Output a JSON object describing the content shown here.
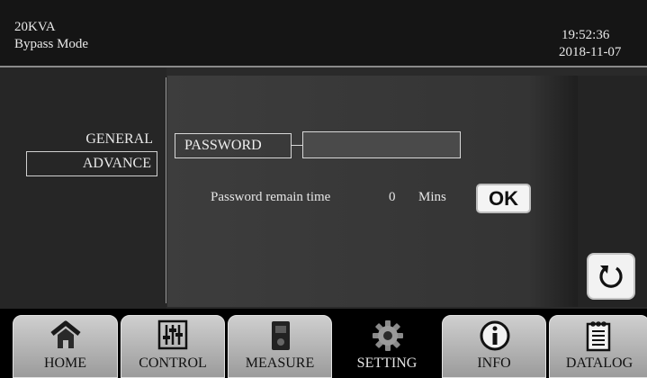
{
  "header": {
    "rating": "20KVA",
    "mode": "Bypass Mode",
    "time": "19:52:36",
    "date": "2018-11-07"
  },
  "menu": {
    "items": [
      {
        "label": "GENERAL",
        "selected": false
      },
      {
        "label": "ADVANCE",
        "selected": true
      }
    ]
  },
  "password": {
    "label": "PASSWORD",
    "value": "",
    "remain_label": "Password remain time",
    "remain_value": "0",
    "remain_unit": "Mins",
    "ok_label": "OK"
  },
  "back_icon": "refresh-icon",
  "nav": {
    "tabs": [
      {
        "label": "HOME",
        "icon": "home-icon",
        "active": false
      },
      {
        "label": "CONTROL",
        "icon": "sliders-icon",
        "active": false
      },
      {
        "label": "MEASURE",
        "icon": "meter-icon",
        "active": false
      },
      {
        "label": "SETTING",
        "icon": "gear-icon",
        "active": true
      },
      {
        "label": "INFO",
        "icon": "info-icon",
        "active": false
      },
      {
        "label": "DATALOG",
        "icon": "notepad-icon",
        "active": false
      }
    ]
  }
}
